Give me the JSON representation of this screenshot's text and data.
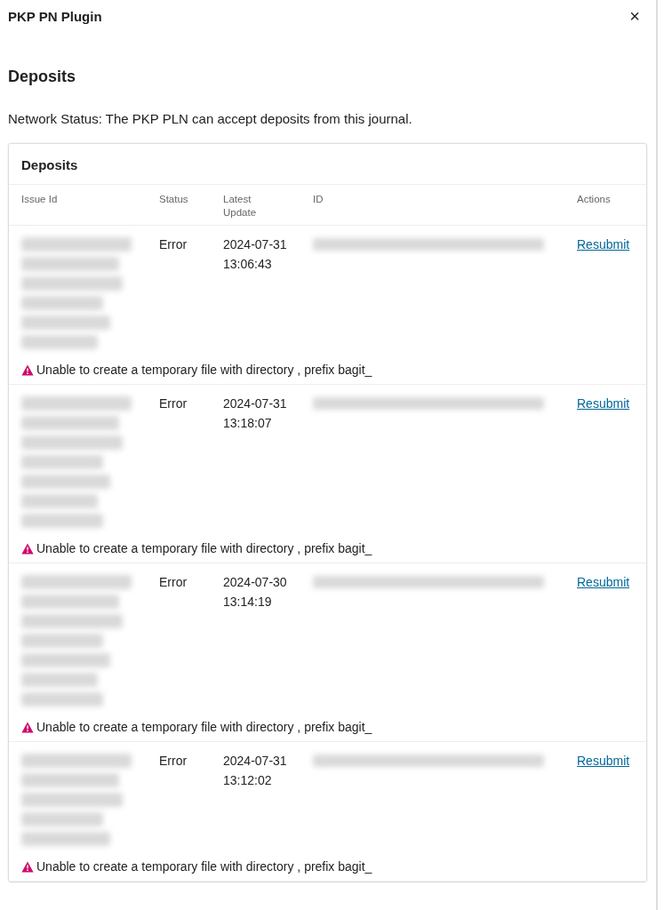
{
  "dialog": {
    "title": "PKP PN Plugin",
    "close": "×"
  },
  "section_title": "Deposits",
  "network_status": "Network Status: The PKP PLN can accept deposits from this journal.",
  "table": {
    "title": "Deposits",
    "columns": [
      "Issue Id",
      "Status",
      "Latest Update",
      "ID",
      "Actions"
    ],
    "rows": [
      {
        "issue_id_lines": [
          {
            "kind": "blurred"
          },
          {
            "kind": "blurred"
          },
          {
            "kind": "blurred"
          },
          {
            "kind": "blurred"
          },
          {
            "kind": "blurred"
          },
          {
            "kind": "blurred"
          }
        ],
        "status": "Error",
        "latest_update": [
          "2024-07-31",
          "13:06:43"
        ],
        "id": {
          "kind": "blurred"
        },
        "action": "Resubmit",
        "message": {
          "kind": "error",
          "text": "Unable to create a temporary file with directory , prefix bagit_"
        }
      },
      {
        "issue_id_lines": [
          {
            "kind": "blurred"
          },
          {
            "kind": "blurred"
          },
          {
            "kind": "blurred"
          },
          {
            "kind": "blurred"
          },
          {
            "kind": "blurred"
          },
          {
            "kind": "blurred"
          },
          {
            "kind": "blurred"
          }
        ],
        "status": "Error",
        "latest_update": [
          "2024-07-31",
          "13:18:07"
        ],
        "id": {
          "kind": "blurred"
        },
        "action": "Resubmit",
        "message": {
          "kind": "error",
          "text": "Unable to create a temporary file with directory , prefix bagit_"
        }
      },
      {
        "issue_id_lines": [
          {
            "kind": "blurred"
          },
          {
            "kind": "blurred"
          },
          {
            "kind": "blurred"
          },
          {
            "kind": "blurred"
          },
          {
            "kind": "blurred"
          },
          {
            "kind": "blurred"
          },
          {
            "kind": "blurred"
          }
        ],
        "status": "Error",
        "latest_update": [
          "2024-07-30",
          "13:14:19"
        ],
        "id": {
          "kind": "blurred"
        },
        "action": "Resubmit",
        "message": {
          "kind": "error",
          "text": "Unable to create a temporary file with directory , prefix bagit_"
        }
      },
      {
        "issue_id_lines": [
          {
            "kind": "blurred"
          },
          {
            "kind": "blurred"
          },
          {
            "kind": "blurred"
          },
          {
            "kind": "blurred"
          },
          {
            "kind": "blurred"
          }
        ],
        "status": "Error",
        "latest_update": [
          "2024-07-31",
          "13:12:02"
        ],
        "id": {
          "kind": "blurred"
        },
        "action": "Resubmit",
        "message": {
          "kind": "error",
          "text": "Unable to create a temporary file with directory , prefix bagit_"
        }
      }
    ]
  }
}
